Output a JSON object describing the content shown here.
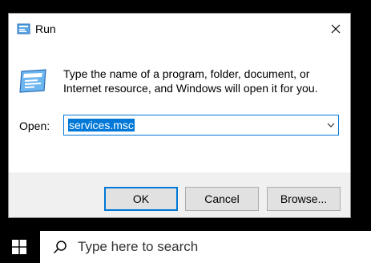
{
  "dialog": {
    "title": "Run",
    "description": "Type the name of a program, folder, document, or Internet resource, and Windows will open it for you.",
    "open_label": "Open:",
    "open_value": "services.msc",
    "buttons": {
      "ok": "OK",
      "cancel": "Cancel",
      "browse": "Browse..."
    },
    "icons": {
      "title": "run-app-icon",
      "big": "run-app-icon",
      "close": "close-icon",
      "dropdown": "chevron-down-icon"
    },
    "colors": {
      "accent": "#0078d7",
      "button_face": "#e1e1e1",
      "dialog_bg": "#f0f0f0"
    }
  },
  "taskbar": {
    "search_placeholder": "Type here to search",
    "icons": {
      "start": "windows-logo-icon",
      "search": "search-icon"
    }
  }
}
